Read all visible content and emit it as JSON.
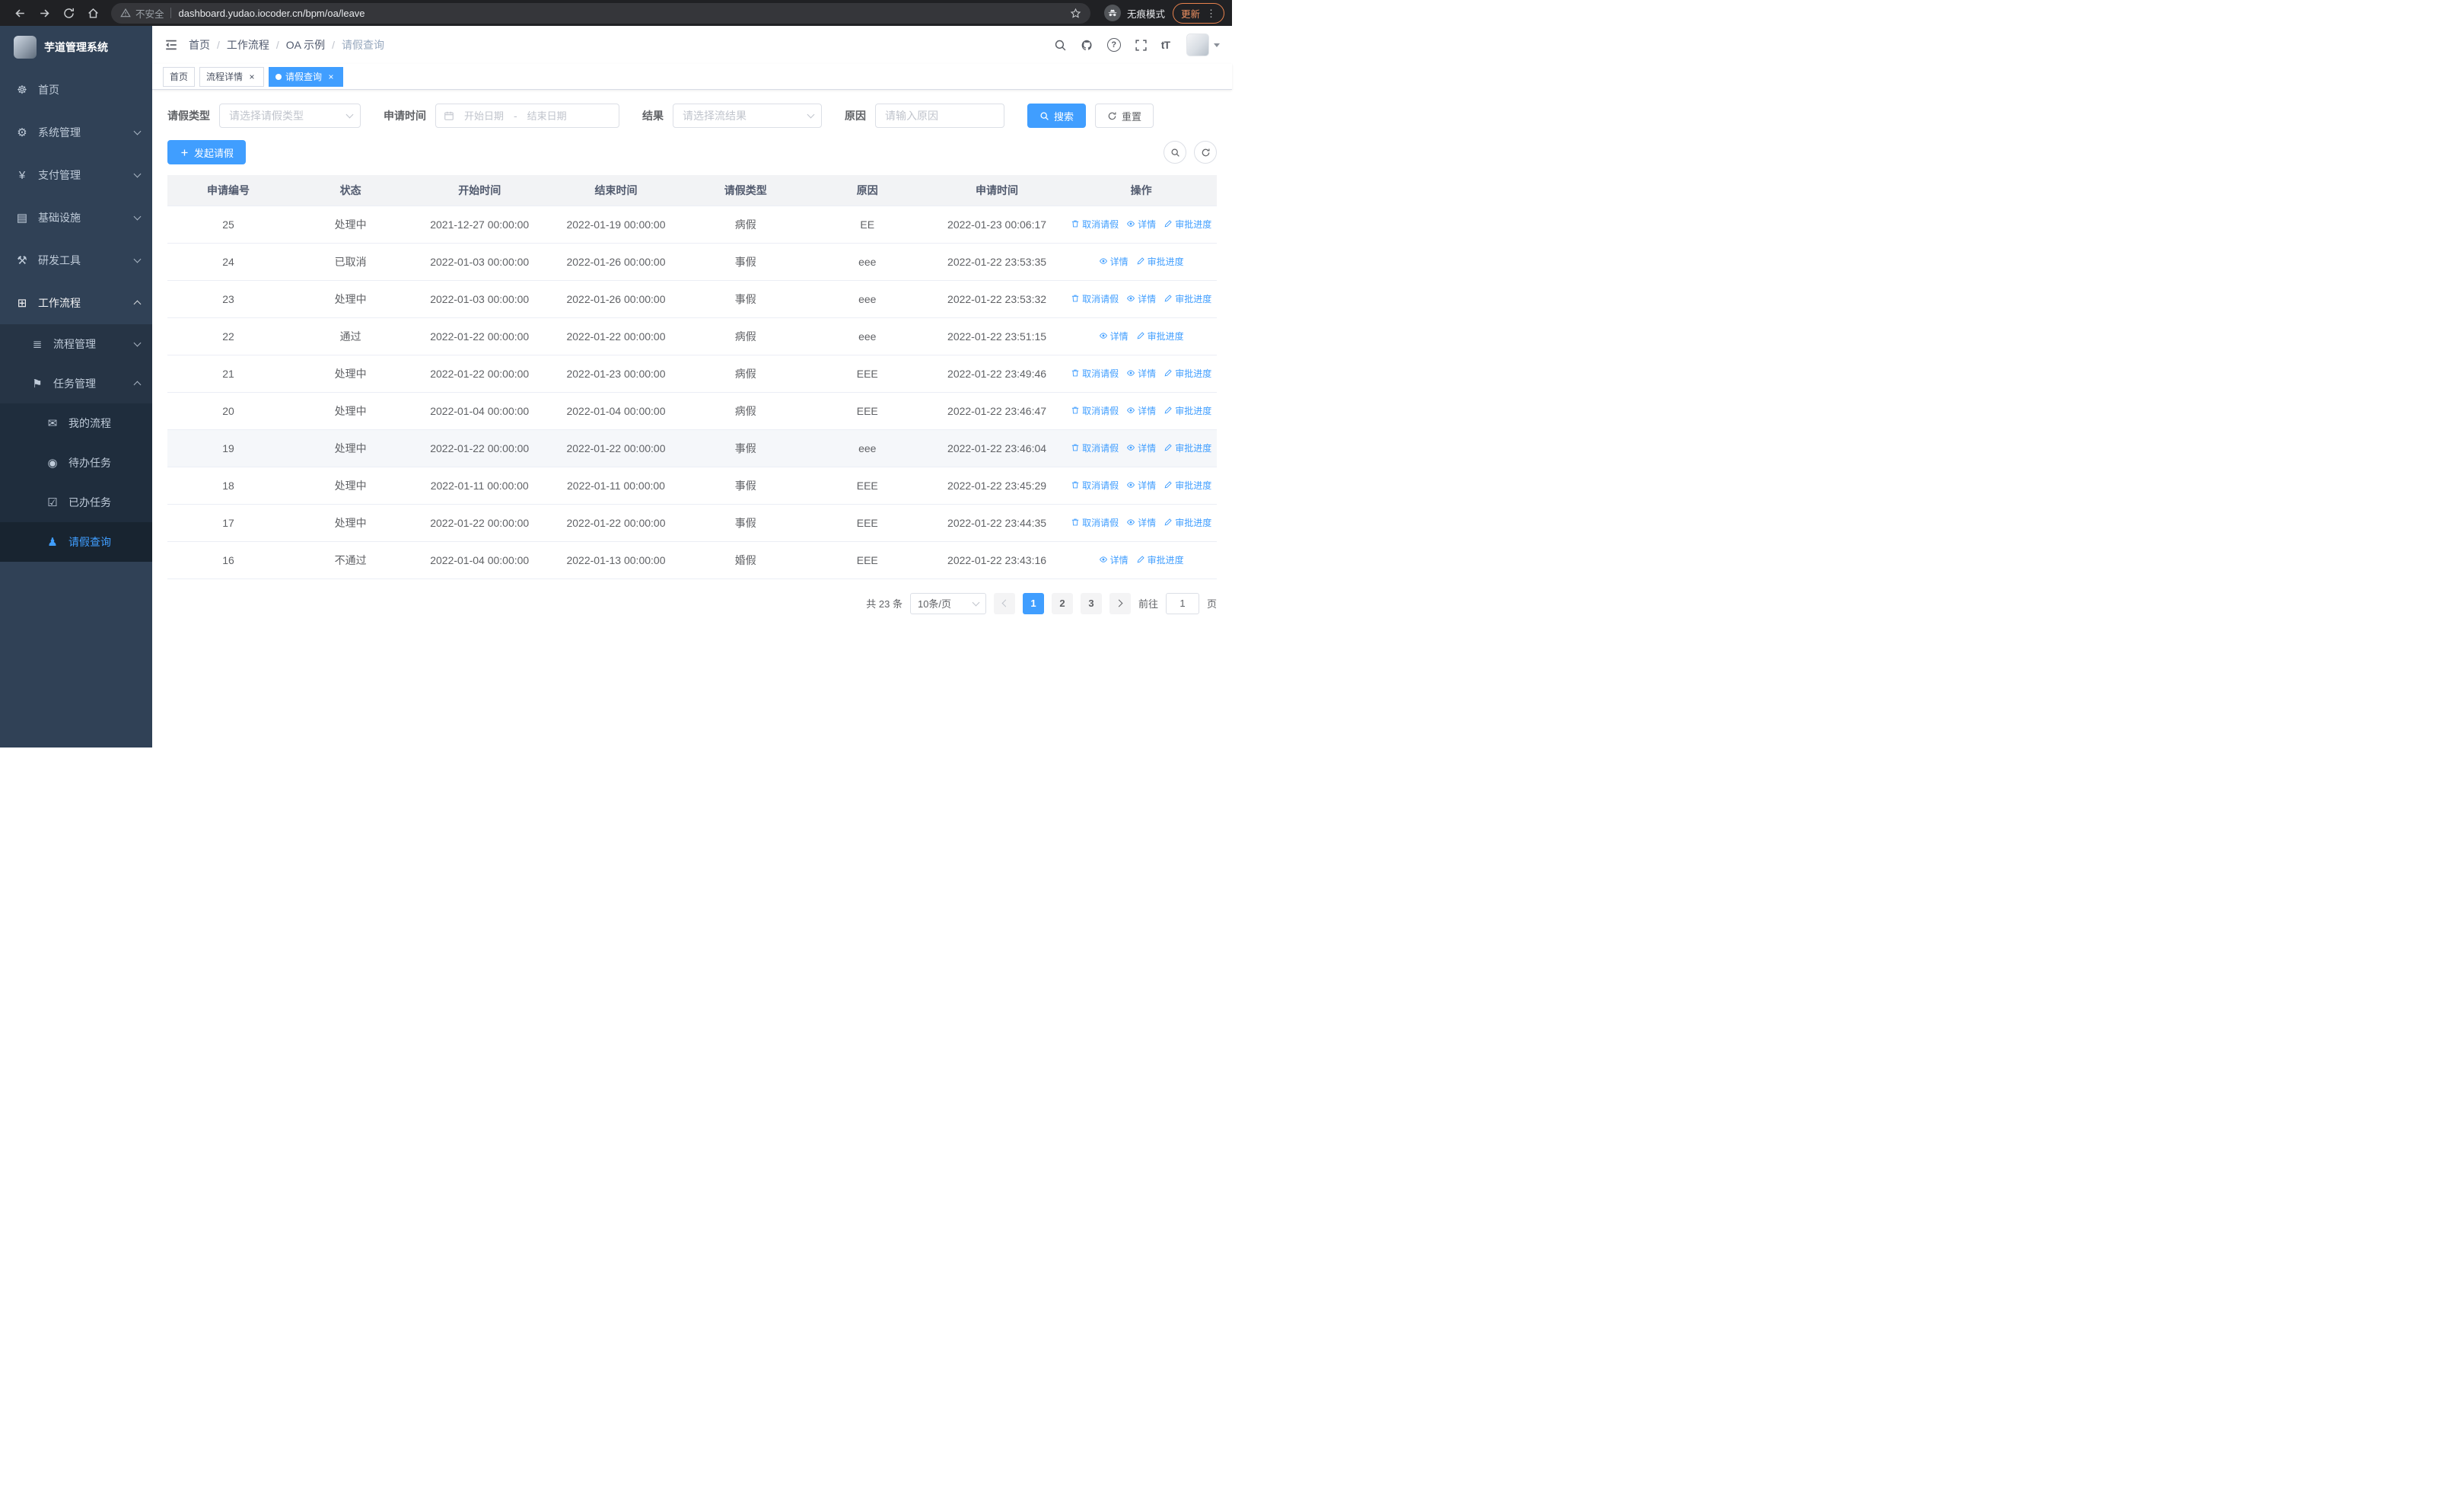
{
  "browser": {
    "security_label": "不安全",
    "url": "dashboard.yudao.iocoder.cn/bpm/oa/leave",
    "incognito_label": "无痕模式",
    "update_label": "更新"
  },
  "icons": {
    "help": "?",
    "font_size": "tT",
    "close": "×",
    "ellipsis": "⋮"
  },
  "sidebar": {
    "app_title": "芋道管理系统",
    "items": {
      "home": {
        "label": "首页",
        "icon": "dashboard-icon",
        "glyph": "☸"
      },
      "system": {
        "label": "系统管理",
        "icon": "gear-icon",
        "glyph": "⚙"
      },
      "payment": {
        "label": "支付管理",
        "icon": "yen-icon",
        "glyph": "¥"
      },
      "infra": {
        "label": "基础设施",
        "icon": "monitor-icon",
        "glyph": "▤"
      },
      "devtools": {
        "label": "研发工具",
        "icon": "tools-icon",
        "glyph": "⚒"
      },
      "workflow": {
        "label": "工作流程",
        "icon": "briefcase-icon",
        "glyph": "⊞"
      },
      "process_mgmt": {
        "label": "流程管理",
        "icon": "list-icon",
        "glyph": "≣"
      },
      "task_mgmt": {
        "label": "任务管理",
        "icon": "flag-icon",
        "glyph": "⚑"
      },
      "my_process": {
        "label": "我的流程",
        "icon": "message-icon",
        "glyph": "✉"
      },
      "todo_tasks": {
        "label": "待办任务",
        "icon": "eye-icon",
        "glyph": "◉"
      },
      "done_tasks": {
        "label": "已办任务",
        "icon": "check-icon",
        "glyph": "☑"
      },
      "leave_query": {
        "label": "请假查询",
        "icon": "user-icon",
        "glyph": "♟"
      }
    }
  },
  "header": {
    "breadcrumb": [
      "首页",
      "工作流程",
      "OA 示例",
      "请假查询"
    ],
    "breadcrumb_separator": "/"
  },
  "tabs": [
    {
      "label": "首页",
      "closable": false,
      "active": false
    },
    {
      "label": "流程详情",
      "closable": true,
      "active": false
    },
    {
      "label": "请假查询",
      "closable": true,
      "active": true
    }
  ],
  "filters": {
    "leave_type_label": "请假类型",
    "leave_type_placeholder": "请选择请假类型",
    "apply_time_label": "申请时间",
    "start_date_placeholder": "开始日期",
    "range_separator": "-",
    "end_date_placeholder": "结束日期",
    "result_label": "结果",
    "result_placeholder": "请选择流结果",
    "reason_label": "原因",
    "reason_placeholder": "请输入原因",
    "search_label": "搜索",
    "reset_label": "重置"
  },
  "toolbar": {
    "create_label": "发起请假"
  },
  "table": {
    "columns": [
      "申请编号",
      "状态",
      "开始时间",
      "结束时间",
      "请假类型",
      "原因",
      "申请时间",
      "操作"
    ],
    "action_labels": {
      "cancel": "取消请假",
      "detail": "详情",
      "progress": "审批进度"
    },
    "rows": [
      {
        "id": "25",
        "status": "处理中",
        "start": "2021-12-27 00:00:00",
        "end": "2022-01-19 00:00:00",
        "type": "病假",
        "reason": "EE",
        "applied": "2022-01-23 00:06:17",
        "actions": [
          "cancel",
          "detail",
          "progress"
        ]
      },
      {
        "id": "24",
        "status": "已取消",
        "start": "2022-01-03 00:00:00",
        "end": "2022-01-26 00:00:00",
        "type": "事假",
        "reason": "eee",
        "applied": "2022-01-22 23:53:35",
        "actions": [
          "detail",
          "progress"
        ]
      },
      {
        "id": "23",
        "status": "处理中",
        "start": "2022-01-03 00:00:00",
        "end": "2022-01-26 00:00:00",
        "type": "事假",
        "reason": "eee",
        "applied": "2022-01-22 23:53:32",
        "actions": [
          "cancel",
          "detail",
          "progress"
        ]
      },
      {
        "id": "22",
        "status": "通过",
        "start": "2022-01-22 00:00:00",
        "end": "2022-01-22 00:00:00",
        "type": "病假",
        "reason": "eee",
        "applied": "2022-01-22 23:51:15",
        "actions": [
          "detail",
          "progress"
        ]
      },
      {
        "id": "21",
        "status": "处理中",
        "start": "2022-01-22 00:00:00",
        "end": "2022-01-23 00:00:00",
        "type": "病假",
        "reason": "EEE",
        "applied": "2022-01-22 23:49:46",
        "actions": [
          "cancel",
          "detail",
          "progress"
        ]
      },
      {
        "id": "20",
        "status": "处理中",
        "start": "2022-01-04 00:00:00",
        "end": "2022-01-04 00:00:00",
        "type": "病假",
        "reason": "EEE",
        "applied": "2022-01-22 23:46:47",
        "actions": [
          "cancel",
          "detail",
          "progress"
        ]
      },
      {
        "id": "19",
        "status": "处理中",
        "start": "2022-01-22 00:00:00",
        "end": "2022-01-22 00:00:00",
        "type": "事假",
        "reason": "eee",
        "applied": "2022-01-22 23:46:04",
        "actions": [
          "cancel",
          "detail",
          "progress"
        ],
        "highlighted": true
      },
      {
        "id": "18",
        "status": "处理中",
        "start": "2022-01-11 00:00:00",
        "end": "2022-01-11 00:00:00",
        "type": "事假",
        "reason": "EEE",
        "applied": "2022-01-22 23:45:29",
        "actions": [
          "cancel",
          "detail",
          "progress"
        ]
      },
      {
        "id": "17",
        "status": "处理中",
        "start": "2022-01-22 00:00:00",
        "end": "2022-01-22 00:00:00",
        "type": "事假",
        "reason": "EEE",
        "applied": "2022-01-22 23:44:35",
        "actions": [
          "cancel",
          "detail",
          "progress"
        ]
      },
      {
        "id": "16",
        "status": "不通过",
        "start": "2022-01-04 00:00:00",
        "end": "2022-01-13 00:00:00",
        "type": "婚假",
        "reason": "EEE",
        "applied": "2022-01-22 23:43:16",
        "actions": [
          "detail",
          "progress"
        ]
      }
    ]
  },
  "pagination": {
    "total_label": "共 23 条",
    "page_size": "10条/页",
    "pages": [
      "1",
      "2",
      "3"
    ],
    "active_page": "1",
    "goto_label": "前往",
    "goto_value": "1",
    "goto_suffix": "页"
  },
  "colors": {
    "primary": "#409eff",
    "sidebar_bg": "#304156",
    "sidebar_sub_bg": "#1f2d3d",
    "chrome_bg": "#202124",
    "update_accent": "#ef9061",
    "table_header_bg": "#f2f3f5"
  }
}
